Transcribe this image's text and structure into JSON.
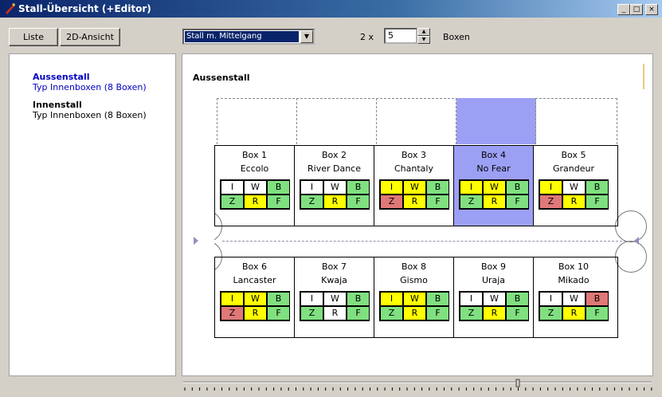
{
  "window": {
    "title": "Stall-Übersicht (+Editor)",
    "min": "_",
    "max": "□",
    "close": "×"
  },
  "toolbar": {
    "liste": "Liste",
    "ansicht": "2D-Ansicht",
    "stall_type": "Stall m. Mittelgang",
    "factor_label": "2 x",
    "count_value": "5",
    "boxes_label": "Boxen"
  },
  "tree": [
    {
      "title": "Aussenstall",
      "subtitle": "Typ Innenboxen (8 Boxen)",
      "selected": true
    },
    {
      "title": "Innenstall",
      "subtitle": "Typ Innenboxen (8 Boxen)",
      "selected": false
    }
  ],
  "stall": {
    "title": "Aussenstall",
    "colors": {
      "yellow": "#ffff00",
      "green": "#80e080",
      "red": "#e07878",
      "white": "#ffffff",
      "highlight": "#9ca0f4"
    },
    "boxes_top": [
      {
        "num": "Box 1",
        "name": "Eccolo",
        "highlight": false,
        "cells": [
          [
            "I",
            "white"
          ],
          [
            "W",
            "white"
          ],
          [
            "B",
            "green"
          ],
          [
            "Z",
            "green"
          ],
          [
            "R",
            "yellow"
          ],
          [
            "F",
            "green"
          ]
        ]
      },
      {
        "num": "Box 2",
        "name": "River Dance",
        "highlight": false,
        "cells": [
          [
            "I",
            "white"
          ],
          [
            "W",
            "white"
          ],
          [
            "B",
            "green"
          ],
          [
            "Z",
            "green"
          ],
          [
            "R",
            "yellow"
          ],
          [
            "F",
            "green"
          ]
        ]
      },
      {
        "num": "Box 3",
        "name": "Chantaly",
        "highlight": false,
        "cells": [
          [
            "I",
            "yellow"
          ],
          [
            "W",
            "yellow"
          ],
          [
            "B",
            "green"
          ],
          [
            "Z",
            "red"
          ],
          [
            "R",
            "yellow"
          ],
          [
            "F",
            "green"
          ]
        ]
      },
      {
        "num": "Box 4",
        "name": "No Fear",
        "highlight": true,
        "cells": [
          [
            "I",
            "yellow"
          ],
          [
            "W",
            "yellow"
          ],
          [
            "B",
            "green"
          ],
          [
            "Z",
            "green"
          ],
          [
            "R",
            "yellow"
          ],
          [
            "F",
            "green"
          ]
        ]
      },
      {
        "num": "Box 5",
        "name": "Grandeur",
        "highlight": false,
        "cells": [
          [
            "I",
            "yellow"
          ],
          [
            "W",
            "white"
          ],
          [
            "B",
            "green"
          ],
          [
            "Z",
            "red"
          ],
          [
            "R",
            "yellow"
          ],
          [
            "F",
            "green"
          ]
        ]
      }
    ],
    "boxes_bottom": [
      {
        "num": "Box 6",
        "name": "Lancaster",
        "highlight": false,
        "cells": [
          [
            "I",
            "yellow"
          ],
          [
            "W",
            "yellow"
          ],
          [
            "B",
            "green"
          ],
          [
            "Z",
            "red"
          ],
          [
            "R",
            "yellow"
          ],
          [
            "F",
            "green"
          ]
        ]
      },
      {
        "num": "Box 7",
        "name": "Kwaja",
        "highlight": false,
        "cells": [
          [
            "I",
            "white"
          ],
          [
            "W",
            "white"
          ],
          [
            "B",
            "green"
          ],
          [
            "Z",
            "green"
          ],
          [
            "R",
            "white"
          ],
          [
            "F",
            "green"
          ]
        ]
      },
      {
        "num": "Box 8",
        "name": "Gismo",
        "highlight": false,
        "cells": [
          [
            "I",
            "yellow"
          ],
          [
            "W",
            "yellow"
          ],
          [
            "B",
            "green"
          ],
          [
            "Z",
            "green"
          ],
          [
            "R",
            "yellow"
          ],
          [
            "F",
            "green"
          ]
        ]
      },
      {
        "num": "Box 9",
        "name": "Uraja",
        "highlight": false,
        "cells": [
          [
            "I",
            "white"
          ],
          [
            "W",
            "white"
          ],
          [
            "B",
            "green"
          ],
          [
            "Z",
            "green"
          ],
          [
            "R",
            "yellow"
          ],
          [
            "F",
            "green"
          ]
        ]
      },
      {
        "num": "Box 10",
        "name": "Mikado",
        "highlight": false,
        "cells": [
          [
            "I",
            "white"
          ],
          [
            "W",
            "white"
          ],
          [
            "B",
            "red"
          ],
          [
            "Z",
            "green"
          ],
          [
            "R",
            "yellow"
          ],
          [
            "F",
            "green"
          ]
        ]
      }
    ]
  }
}
